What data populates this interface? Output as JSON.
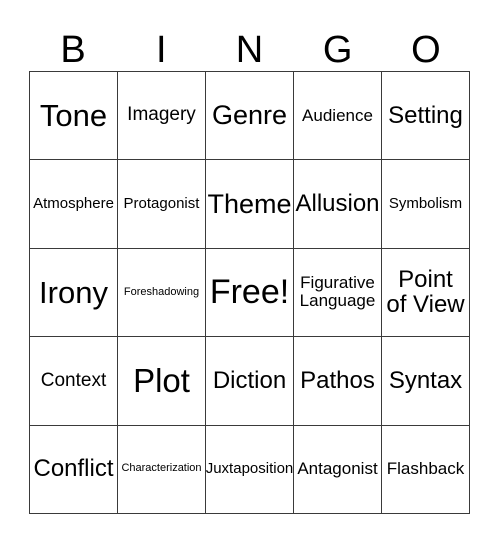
{
  "card": {
    "title": "BINGO",
    "header_letters": [
      "B",
      "I",
      "N",
      "G",
      "O"
    ],
    "colors": {
      "background": "#ffffff",
      "text": "#000000",
      "border": "#3a3a3a"
    },
    "grid": {
      "rows": 5,
      "columns": 5,
      "free_space": "Free!",
      "cells": [
        [
          {
            "label": "Tone",
            "size": "s-4xl"
          },
          {
            "label": "Imagery",
            "size": "s-lg"
          },
          {
            "label": "Genre",
            "size": "s-3xl"
          },
          {
            "label": "Audience",
            "size": "s-md"
          },
          {
            "label": "Setting",
            "size": "s-2xl"
          }
        ],
        [
          {
            "label": "Atmosphere",
            "size": "s-sm"
          },
          {
            "label": "Protagonist",
            "size": "s-sm"
          },
          {
            "label": "Theme",
            "size": "s-3xl"
          },
          {
            "label": "Allusion",
            "size": "s-2xl"
          },
          {
            "label": "Symbolism",
            "size": "s-sm"
          }
        ],
        [
          {
            "label": "Irony",
            "size": "s-4xl"
          },
          {
            "label": "Foreshadowing",
            "size": "s-xs"
          },
          {
            "label": "Free!",
            "size": "s-6xl"
          },
          {
            "label": "Figurative\nLanguage",
            "size": "s-md"
          },
          {
            "label": "Point\nof View",
            "size": "s-2xl"
          }
        ],
        [
          {
            "label": "Context",
            "size": "s-lg"
          },
          {
            "label": "Plot",
            "size": "s-5xl"
          },
          {
            "label": "Diction",
            "size": "s-2xl"
          },
          {
            "label": "Pathos",
            "size": "s-2xl"
          },
          {
            "label": "Syntax",
            "size": "s-2xl"
          }
        ],
        [
          {
            "label": "Conflict",
            "size": "s-2xl"
          },
          {
            "label": "Characterization",
            "size": "s-xs"
          },
          {
            "label": "Juxtaposition",
            "size": "s-sm"
          },
          {
            "label": "Antagonist",
            "size": "s-md"
          },
          {
            "label": "Flashback",
            "size": "s-md"
          }
        ]
      ]
    }
  }
}
